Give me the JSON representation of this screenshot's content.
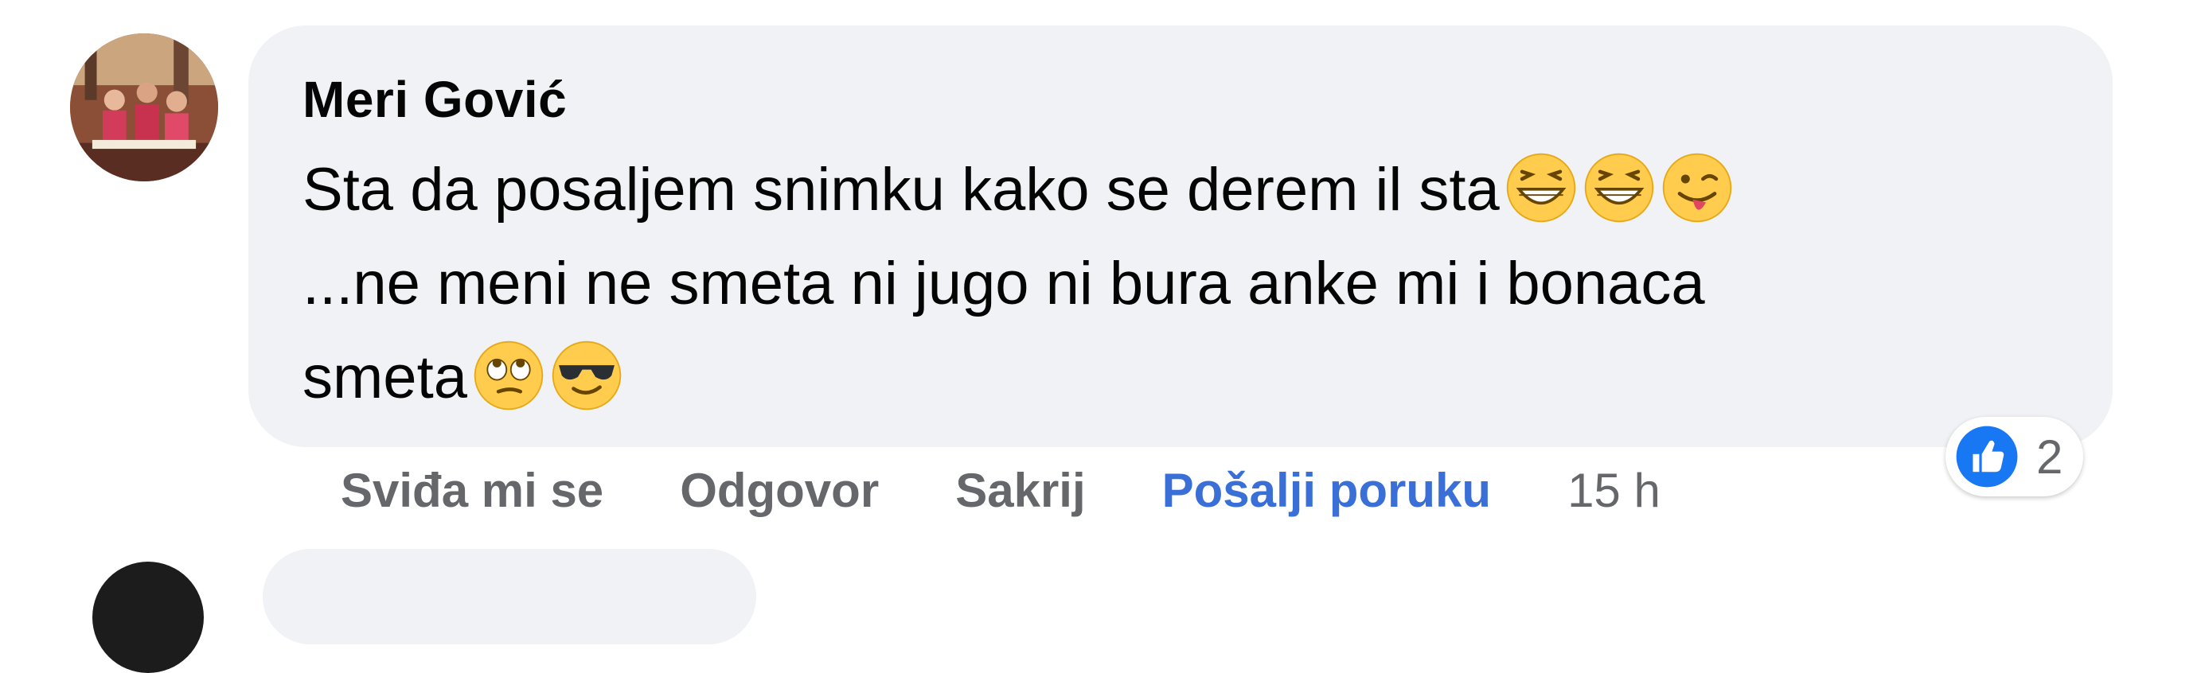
{
  "comment": {
    "author": "Meri Gović",
    "text_lines": [
      "Sta da posaljem snimku kako se derem il sta",
      "...ne meni ne smeta ni jugo ni bura anke mi i bonaca",
      "smeta"
    ],
    "emojis_line1": [
      "grinning-squinting-face",
      "grinning-squinting-face",
      "winking-face-with-tongue"
    ],
    "emojis_line3": [
      "face-with-rolling-eyes",
      "smiling-face-with-sunglasses"
    ]
  },
  "reactions": {
    "icon": "like-icon",
    "count": "2"
  },
  "actions": {
    "like": "Sviđa mi se",
    "reply": "Odgovor",
    "hide": "Sakrij",
    "send_message": "Pošalji poruku",
    "time": "15 h"
  },
  "colors": {
    "bubble_bg": "#f0f2f5",
    "action_gray": "#65676b",
    "link_blue": "#3a6fd8",
    "like_blue": "#1877f2"
  }
}
